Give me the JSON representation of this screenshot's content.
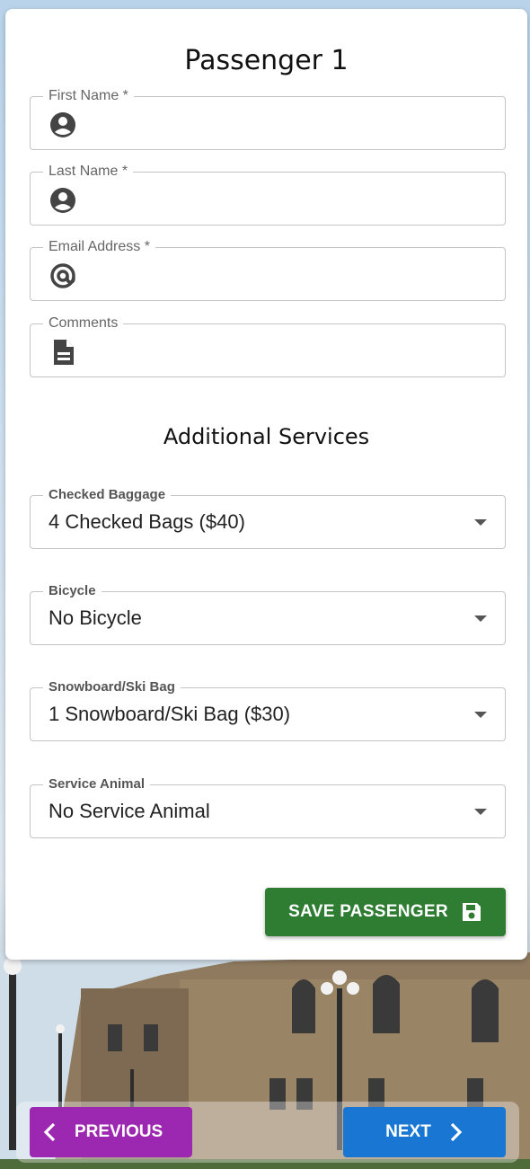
{
  "passenger_title": "Passenger 1",
  "fields": [
    {
      "label": "First Name *",
      "value": "",
      "icon": "account-circle-icon"
    },
    {
      "label": "Last Name *",
      "value": "",
      "icon": "account-circle-icon"
    },
    {
      "label": "Email Address *",
      "value": "",
      "icon": "at-sign-icon"
    },
    {
      "label": "Comments",
      "value": "",
      "icon": "document-icon"
    }
  ],
  "additional_services_title": "Additional Services",
  "services": [
    {
      "label": "Checked Baggage",
      "value": "4 Checked Bags ($40)"
    },
    {
      "label": "Bicycle",
      "value": "No Bicycle"
    },
    {
      "label": "Snowboard/Ski Bag",
      "value": "1 Snowboard/Ski Bag ($30)"
    },
    {
      "label": "Service Animal",
      "value": "No Service Animal"
    }
  ],
  "save_button_label": "SAVE PASSENGER",
  "previous_button_label": "PREVIOUS",
  "next_button_label": "NEXT",
  "colors": {
    "save": "#2e7d32",
    "previous": "#9c27b0",
    "next": "#1976d2"
  }
}
